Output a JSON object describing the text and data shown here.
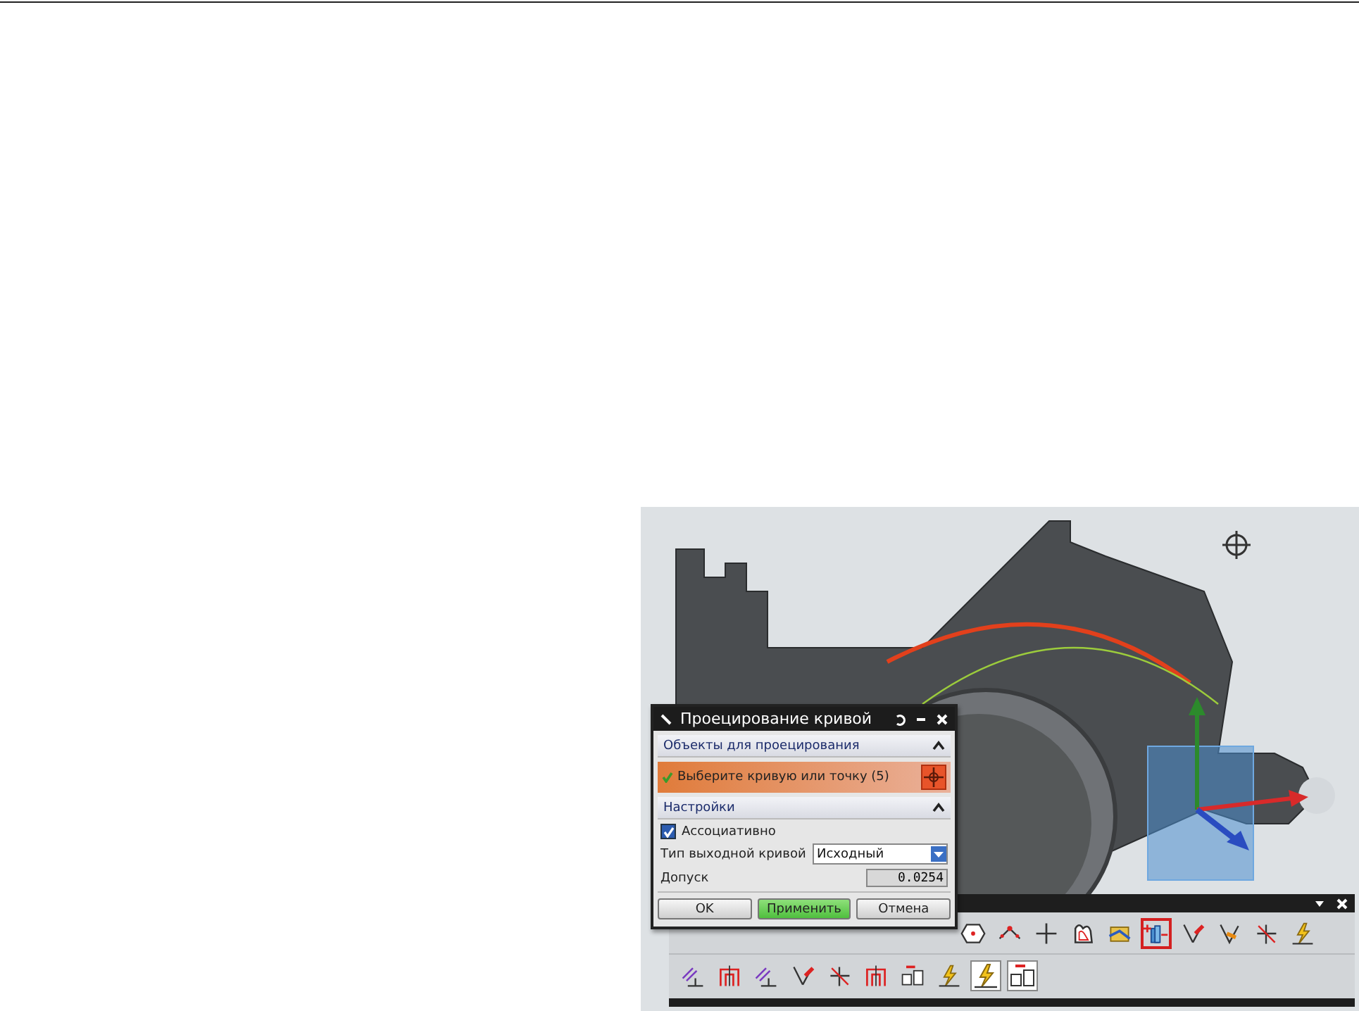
{
  "dialog": {
    "title": "Проецирование кривой",
    "sections": [
      {
        "title": "Объекты для проецирования",
        "expanded": true
      },
      {
        "title": "Настройки",
        "expanded": true
      }
    ],
    "selection": {
      "label": "Выберите кривую или точку (5)",
      "done": true
    },
    "associative": {
      "label": "Ассоциативно",
      "checked": true
    },
    "output_type": {
      "label": "Тип выходной кривой",
      "value": "Исходный"
    },
    "tolerance": {
      "label": "Допуск",
      "value": "0.0254"
    },
    "buttons": [
      {
        "label": "OK",
        "default": false
      },
      {
        "label": "Применить",
        "default": true
      },
      {
        "label": "Отмена",
        "default": false
      }
    ]
  },
  "toolbar": {
    "rows": [
      [
        {
          "kind": "hexagon",
          "selected": false,
          "pressed": false
        },
        {
          "kind": "node",
          "selected": false,
          "pressed": false
        },
        {
          "kind": "plus",
          "selected": false,
          "pressed": false
        },
        {
          "kind": "blob",
          "selected": false,
          "pressed": false
        },
        {
          "kind": "folder",
          "selected": false,
          "pressed": false
        },
        {
          "kind": "project",
          "selected": true,
          "pressed": false
        },
        {
          "kind": "pencil",
          "selected": false,
          "pressed": false
        },
        {
          "kind": "pencil2",
          "selected": false,
          "pressed": false
        },
        {
          "kind": "cross",
          "selected": false,
          "pressed": false
        },
        {
          "kind": "bolt",
          "selected": false,
          "pressed": false
        }
      ],
      [
        {
          "kind": "offset",
          "selected": false,
          "pressed": false
        },
        {
          "kind": "bridge",
          "selected": false,
          "pressed": false
        },
        {
          "kind": "offset",
          "selected": false,
          "pressed": false
        },
        {
          "kind": "pencil",
          "selected": false,
          "pressed": false
        },
        {
          "kind": "cross",
          "selected": false,
          "pressed": false
        },
        {
          "kind": "bridge",
          "selected": false,
          "pressed": false
        },
        {
          "kind": "blocks",
          "selected": false,
          "pressed": false
        },
        {
          "kind": "bolt",
          "selected": false,
          "pressed": false
        },
        {
          "kind": "bolt",
          "selected": false,
          "pressed": true
        },
        {
          "kind": "blocks",
          "selected": false,
          "pressed": true
        }
      ]
    ]
  }
}
